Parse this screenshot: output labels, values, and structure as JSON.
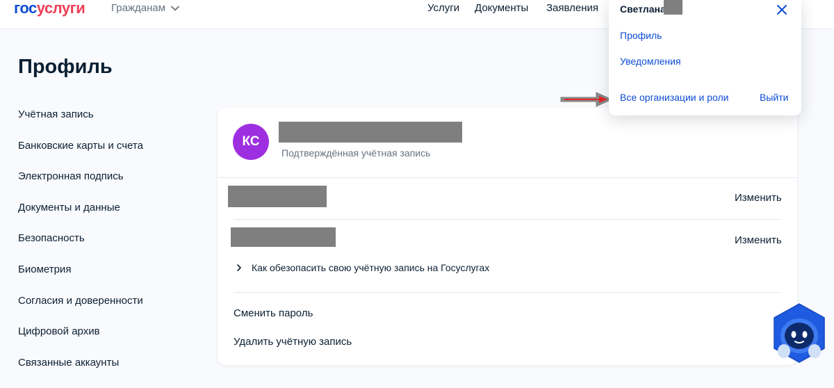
{
  "header": {
    "logo_part1": "гос",
    "logo_part2": "услуги",
    "citizens_label": "Гражданам",
    "nav": [
      "Услуги",
      "Документы",
      "Заявления"
    ]
  },
  "page": {
    "title": "Профиль"
  },
  "sidebar": {
    "items": [
      "Учётная запись",
      "Банковские карты и счета",
      "Электронная подпись",
      "Документы и данные",
      "Безопасность",
      "Биометрия",
      "Согласия и доверенности",
      "Цифровой архив",
      "Связанные аккаунты"
    ]
  },
  "account": {
    "avatar_initials": "КС",
    "status": "Подтверждённая учётная запись",
    "change_label": "Изменить",
    "secure_link": "Как обезопасить свою учётную запись на Госуслугах",
    "change_password": "Сменить пароль",
    "delete_account": "Удалить учётную запись"
  },
  "dropdown": {
    "user_name": "Светлана",
    "profile": "Профиль",
    "notifications": "Уведомления",
    "all_orgs": "Все организации и роли",
    "logout": "Выйти"
  },
  "colors": {
    "brand_blue": "#0d4cd3",
    "brand_red": "#ee3f58",
    "avatar_purple": "#9d2fe0",
    "redaction_gray": "#7f7f7f",
    "annotation_arrow": "#e02828"
  },
  "icons": {
    "chevron": "chevron-down-icon",
    "close": "close-icon",
    "secure_chevron": "chevron-right-icon",
    "annotation": "arrow-right-icon",
    "assistant": "robot-assistant-icon"
  }
}
